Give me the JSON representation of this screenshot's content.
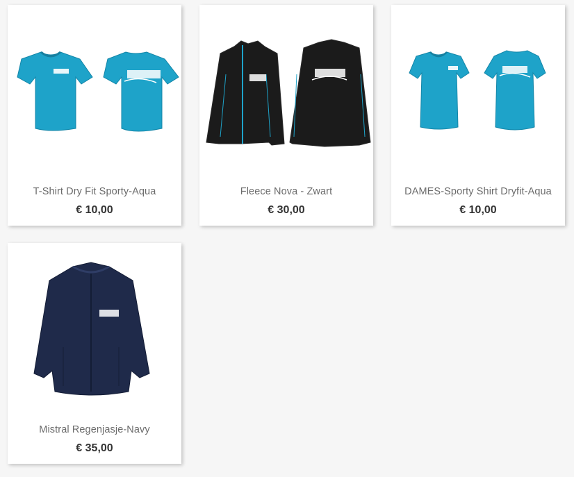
{
  "colors": {
    "page_background": "#f6f6f6",
    "card_background": "#ffffff",
    "name_text": "#6b6b6b",
    "price_text": "#333333",
    "aqua": "#1ea3c9",
    "black": "#1b1b1b",
    "navy": "#1f2a4a"
  },
  "products": [
    {
      "name": "T-Shirt Dry Fit Sporty-Aqua",
      "price": "€ 10,00",
      "image_icon": "aqua-tshirt-front-back-image"
    },
    {
      "name": "Fleece Nova - Zwart",
      "price": "€ 30,00",
      "image_icon": "black-fleece-front-back-image"
    },
    {
      "name": "DAMES-Sporty Shirt Dryfit-Aqua",
      "price": "€ 10,00",
      "image_icon": "aqua-ladies-shirt-front-back-image"
    },
    {
      "name": "Mistral Regenjasje-Navy",
      "price": "€ 35,00",
      "image_icon": "navy-rain-jacket-image"
    }
  ]
}
